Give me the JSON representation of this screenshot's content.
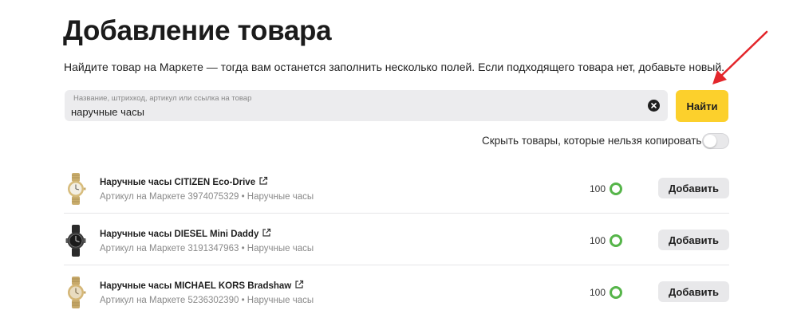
{
  "header": {
    "title": "Добавление товара",
    "subtitle": "Найдите товар на Маркете — тогда вам останется заполнить несколько полей. Если подходящего товара нет, добавьте новый."
  },
  "search": {
    "placeholder": "Название, штрихкод, артикул или ссылка на товар",
    "value": "наручные часы",
    "find_label": "Найти"
  },
  "filter": {
    "hide_uncopyable_label": "Скрыть товары, которые нельзя копировать",
    "hide_uncopyable_enabled": false
  },
  "products": [
    {
      "name": "Наручные часы CITIZEN Eco-Drive",
      "meta": "Артикул на Маркете 3974075329 • Наручные часы",
      "score": "100",
      "add_label": "Добавить",
      "thumb": "gold-watch"
    },
    {
      "name": "Наручные часы DIESEL Mini Daddy",
      "meta": "Артикул на Маркете 3191347963 • Наручные часы",
      "score": "100",
      "add_label": "Добавить",
      "thumb": "black-watch"
    },
    {
      "name": "Наручные часы MICHAEL KORS Bradshaw",
      "meta": "Артикул на Маркете 5236302390 • Наручные часы",
      "score": "100",
      "add_label": "Добавить",
      "thumb": "gold-watch"
    }
  ],
  "colors": {
    "accent": "#fcd02c",
    "score_ring": "#56b54a",
    "annotation_arrow": "#e3262b"
  },
  "icons": {
    "clear": "clear-circle-x-icon",
    "external_link": "external-link-icon",
    "annotation": "red-arrow-annotation"
  }
}
